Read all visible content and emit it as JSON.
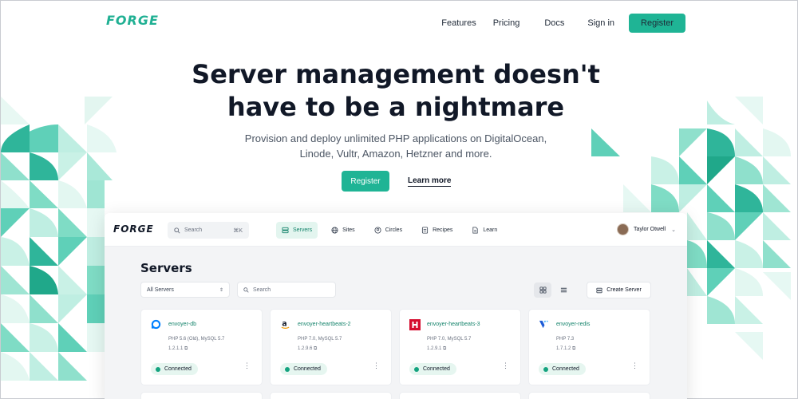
{
  "site": {
    "logo": "FORGE",
    "nav": {
      "features": "Features",
      "pricing": "Pricing",
      "docs": "Docs",
      "sign_in": "Sign in",
      "register": "Register"
    }
  },
  "hero": {
    "title_line1": "Server management doesn't",
    "title_line2": "have to be a nightmare",
    "subtitle_line1": "Provision and deploy unlimited PHP applications on DigitalOcean,",
    "subtitle_line2": "Linode, Vultr, Amazon, Hetzner and more.",
    "register": "Register",
    "learn_more": "Learn more"
  },
  "app": {
    "logo": "FORGE",
    "search_placeholder": "Search",
    "search_shortcut": "⌘K",
    "nav": [
      {
        "label": "Servers",
        "icon": "server-icon",
        "active": true
      },
      {
        "label": "Sites",
        "icon": "globe-icon",
        "active": false
      },
      {
        "label": "Circles",
        "icon": "circle-user-icon",
        "active": false
      },
      {
        "label": "Recipes",
        "icon": "recipe-icon",
        "active": false
      },
      {
        "label": "Learn",
        "icon": "document-icon",
        "active": false
      }
    ],
    "user": "Taylor Otwell",
    "page_title": "Servers",
    "filter_value": "All Servers",
    "search2_placeholder": "Search",
    "create_server": "Create Server",
    "cards": [
      {
        "name": "envoyer-db",
        "provider_icon": "digitalocean-icon",
        "provider_color": "#0080ff",
        "meta": "PHP 5.6 (Old), MySQL 5.7",
        "version": "1.2.1.1",
        "status": "Connected"
      },
      {
        "name": "envoyer-heartbeats-2",
        "provider_icon": "amazon-icon",
        "provider_color": "#111827",
        "meta": "PHP 7.0, MySQL 5.7",
        "version": "1.2.9.6",
        "status": "Connected"
      },
      {
        "name": "envoyer-heartbeats-3",
        "provider_icon": "hetzner-icon",
        "provider_color": "#d50c2d",
        "meta": "PHP 7.0, MySQL 5.7",
        "version": "1.2.9.1",
        "status": "Connected"
      },
      {
        "name": "envoyer-redis",
        "provider_icon": "vultr-icon",
        "provider_color": "#1e5cd6",
        "meta": "PHP 7.3",
        "version": "1.7.1.2",
        "status": "Connected"
      }
    ]
  },
  "colors": {
    "brand": "#1fb495",
    "link_green": "#14836b",
    "text": "#111827"
  }
}
